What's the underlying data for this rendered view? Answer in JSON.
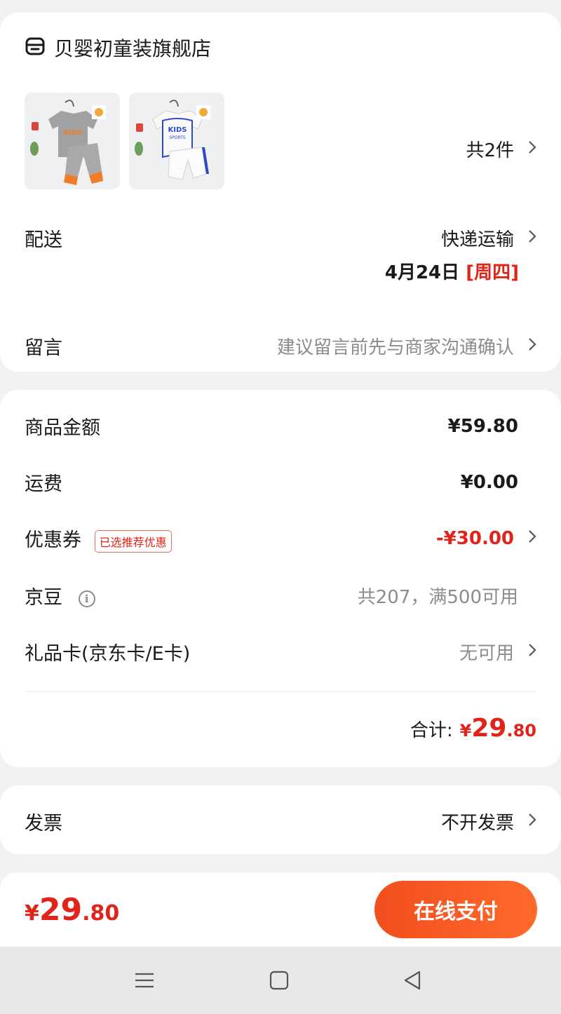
{
  "store": {
    "icon": "store-icon",
    "name": "贝婴初童装旗舰店",
    "items": [
      {
        "thumb": "product-thumb-gray-kids-set",
        "accent": "#f07d2a"
      },
      {
        "thumb": "product-thumb-white-kids-set",
        "accent": "#2e49c9"
      }
    ],
    "count_label": "共2件"
  },
  "delivery": {
    "label": "配送",
    "method": "快递运输",
    "date": "4月24日",
    "weekday": "[周四]"
  },
  "message": {
    "label": "留言",
    "placeholder": "建议留言前先与商家沟通确认"
  },
  "price": {
    "goods_label": "商品金额",
    "goods_value": "¥59.80",
    "shipping_label": "运费",
    "shipping_value": "¥0.00",
    "coupon_label": "优惠券",
    "coupon_tag": "已选推荐优惠",
    "coupon_value": "-¥30.00",
    "beans_label": "京豆",
    "beans_value": "共207，满500可用",
    "giftcard_label": "礼品卡(京东卡/E卡)",
    "giftcard_value": "无可用",
    "total_label": "合计:",
    "total_yuan": "¥",
    "total_int": "29",
    "total_dec": ".80"
  },
  "invoice": {
    "label": "发票",
    "value": "不开发票"
  },
  "footer": {
    "yuan": "¥",
    "amount_int": "29",
    "amount_dec": ".80",
    "pay_label": "在线支付"
  },
  "colors": {
    "accent_red": "#e2231a",
    "pay_gradient_start": "#f24e1e",
    "pay_gradient_end": "#ff6a2c"
  }
}
